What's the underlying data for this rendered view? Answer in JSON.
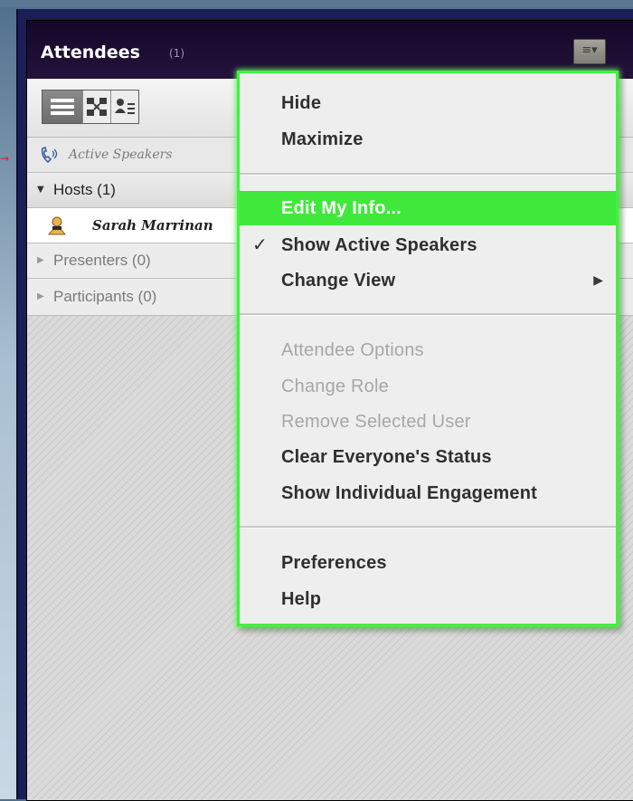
{
  "pod": {
    "title": "Attendees",
    "count": "(1)",
    "menu_button_icon": "pod-menu-icon",
    "view_buttons": [
      "list-view-icon",
      "breakout-view-icon",
      "attendee-status-view-icon"
    ],
    "active_speakers_label": "Active Speakers",
    "groups": [
      {
        "label": "Hosts (1)",
        "expanded": true,
        "members": [
          "Sarah Marrinan"
        ]
      },
      {
        "label": "Presenters (0)",
        "expanded": false
      },
      {
        "label": "Participants (0)",
        "expanded": false
      }
    ]
  },
  "menu": {
    "items": {
      "hide": "Hide",
      "maximize": "Maximize",
      "edit_my_info": "Edit My Info...",
      "show_active_speakers": "Show Active Speakers",
      "change_view": "Change View",
      "attendee_options": "Attendee Options",
      "change_role": "Change Role",
      "remove_selected_user": "Remove Selected User",
      "clear_status": "Clear Everyone's Status",
      "show_engagement": "Show Individual Engagement",
      "preferences": "Preferences",
      "help": "Help"
    },
    "check_mark": "✓",
    "submenu_arrow": "▶"
  },
  "colors": {
    "highlight": "#3fe83a",
    "frame": "#1c1e55",
    "titlebar": "#14082a",
    "callout_border": "#3ff33d"
  }
}
